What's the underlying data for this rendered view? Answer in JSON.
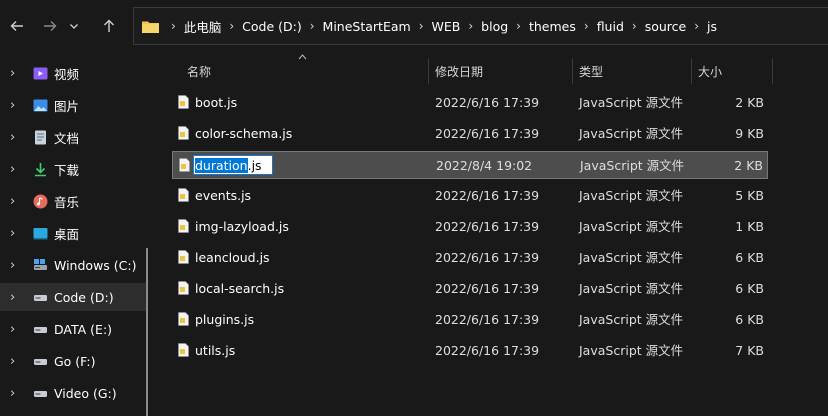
{
  "nav": {
    "back_icon": "arrow-left-icon",
    "forward_icon": "arrow-right-icon",
    "recent_icon": "chevron-down-icon",
    "up_icon": "arrow-up-icon"
  },
  "address": {
    "folder_icon": "folder-icon",
    "crumbs": [
      "此电脑",
      "Code (D:)",
      "MineStartEam",
      "WEB",
      "blog",
      "themes",
      "fluid",
      "source",
      "js"
    ]
  },
  "sidebar": {
    "items": [
      {
        "label": "视频",
        "icon": "video-icon"
      },
      {
        "label": "图片",
        "icon": "pictures-icon"
      },
      {
        "label": "文档",
        "icon": "documents-icon"
      },
      {
        "label": "下载",
        "icon": "download-icon"
      },
      {
        "label": "音乐",
        "icon": "music-icon"
      },
      {
        "label": "桌面",
        "icon": "desktop-icon"
      },
      {
        "label": "Windows (C:)",
        "icon": "windows-drive-icon"
      },
      {
        "label": "Code (D:)",
        "icon": "drive-icon"
      },
      {
        "label": "DATA (E:)",
        "icon": "drive-icon"
      },
      {
        "label": "Go (F:)",
        "icon": "drive-icon"
      },
      {
        "label": "Video (G:)",
        "icon": "drive-icon"
      }
    ],
    "selected": "Code (D:)"
  },
  "columns": {
    "name": "名称",
    "date": "修改日期",
    "type": "类型",
    "size": "大小"
  },
  "files": [
    {
      "name": "boot.js",
      "date": "2022/6/16 17:39",
      "type": "JavaScript 源文件",
      "size": "2 KB"
    },
    {
      "name": "color-schema.js",
      "date": "2022/6/16 17:39",
      "type": "JavaScript 源文件",
      "size": "9 KB"
    },
    {
      "name": "duration.js",
      "date": "2022/8/4 19:02",
      "type": "JavaScript 源文件",
      "size": "2 KB",
      "renaming": true,
      "rename_selected": "duration",
      "rename_rest": ".js"
    },
    {
      "name": "events.js",
      "date": "2022/6/16 17:39",
      "type": "JavaScript 源文件",
      "size": "5 KB"
    },
    {
      "name": "img-lazyload.js",
      "date": "2022/6/16 17:39",
      "type": "JavaScript 源文件",
      "size": "1 KB"
    },
    {
      "name": "leancloud.js",
      "date": "2022/6/16 17:39",
      "type": "JavaScript 源文件",
      "size": "6 KB"
    },
    {
      "name": "local-search.js",
      "date": "2022/6/16 17:39",
      "type": "JavaScript 源文件",
      "size": "6 KB"
    },
    {
      "name": "plugins.js",
      "date": "2022/6/16 17:39",
      "type": "JavaScript 源文件",
      "size": "6 KB"
    },
    {
      "name": "utils.js",
      "date": "2022/6/16 17:39",
      "type": "JavaScript 源文件",
      "size": "7 KB"
    }
  ],
  "colors": {
    "background": "#191919",
    "selected_row": "#4d4d4d",
    "rename_highlight": "#0078d7",
    "folder_yellow": "#f2c84b"
  }
}
